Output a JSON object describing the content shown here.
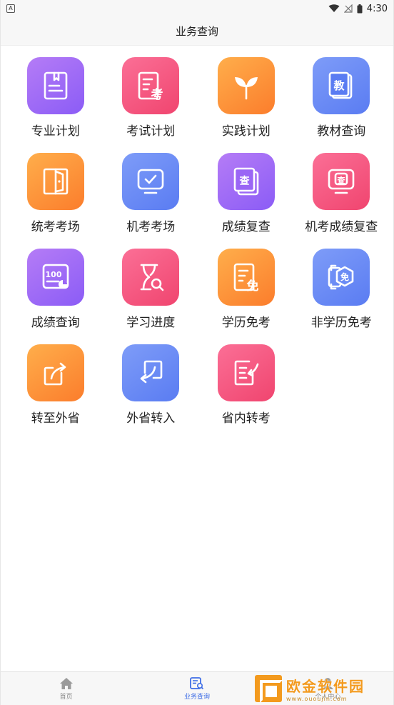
{
  "status_bar": {
    "left_badge": "A",
    "time": "4:30"
  },
  "title": "业务查询",
  "grid": [
    {
      "label": "专业计划",
      "color": "purple",
      "icon": "notebook-icon"
    },
    {
      "label": "考试计划",
      "color": "pink",
      "icon": "exam-doc-icon",
      "glyph": "考"
    },
    {
      "label": "实践计划",
      "color": "orange",
      "icon": "sprout-icon"
    },
    {
      "label": "教材查询",
      "color": "blue",
      "icon": "textbook-icon",
      "glyph": "教"
    },
    {
      "label": "统考考场",
      "color": "orange",
      "icon": "door-icon"
    },
    {
      "label": "机考考场",
      "color": "blue",
      "icon": "monitor-check-icon"
    },
    {
      "label": "成绩复查",
      "color": "purple",
      "icon": "stack-check-icon",
      "glyph": "查"
    },
    {
      "label": "机考成绩复查",
      "color": "pink",
      "icon": "monitor-check-icon",
      "glyph": "查"
    },
    {
      "label": "成绩查询",
      "color": "purple",
      "icon": "score-icon",
      "glyph": "100"
    },
    {
      "label": "学习进度",
      "color": "pink",
      "icon": "progress-search-icon"
    },
    {
      "label": "学历免考",
      "color": "orange",
      "icon": "exempt-doc-icon",
      "glyph": "免"
    },
    {
      "label": "非学历免考",
      "color": "blue",
      "icon": "exempt-badge-icon",
      "glyph": "免"
    },
    {
      "label": "转至外省",
      "color": "orange",
      "icon": "transfer-out-icon"
    },
    {
      "label": "外省转入",
      "color": "blue",
      "icon": "transfer-in-icon"
    },
    {
      "label": "省内转考",
      "color": "pink",
      "icon": "list-transfer-icon"
    }
  ],
  "bottom_nav": [
    {
      "label": "首页",
      "icon": "home-icon",
      "active": false
    },
    {
      "label": "业务查询",
      "icon": "query-icon",
      "active": true
    },
    {
      "label": "个人中心",
      "icon": "user-icon",
      "active": false
    }
  ],
  "watermark": {
    "text": "欧金软件园",
    "sub": "www.ououjin.com"
  },
  "colors": {
    "active": "#3f6ee6",
    "watermark": "#f39a1e"
  }
}
